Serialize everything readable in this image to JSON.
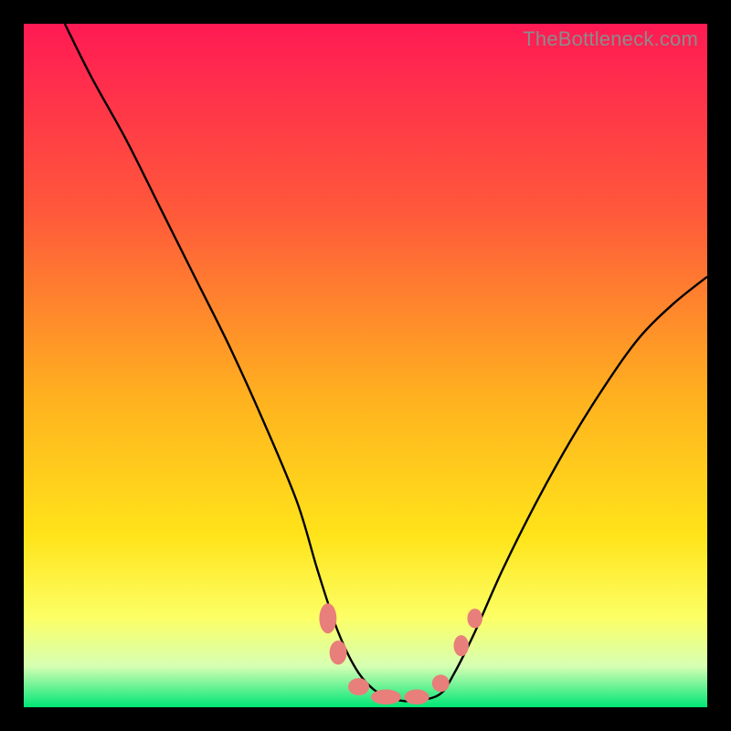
{
  "attribution": "TheBottleneck.com",
  "chart_data": {
    "type": "line",
    "title": "",
    "xlabel": "",
    "ylabel": "",
    "xlim": [
      0,
      100
    ],
    "ylim": [
      0,
      100
    ],
    "gradient_stops": [
      {
        "offset": 0,
        "color": "#ff1a54"
      },
      {
        "offset": 28,
        "color": "#ff5a3a"
      },
      {
        "offset": 55,
        "color": "#ffb21f"
      },
      {
        "offset": 75,
        "color": "#ffe41a"
      },
      {
        "offset": 87,
        "color": "#fcff66"
      },
      {
        "offset": 94,
        "color": "#d6ffb3"
      },
      {
        "offset": 100,
        "color": "#00e676"
      }
    ],
    "series": [
      {
        "name": "bottleneck-curve",
        "x": [
          6,
          10,
          15,
          20,
          25,
          30,
          35,
          40,
          43,
          46,
          49,
          52,
          55,
          58,
          61,
          63,
          66,
          70,
          75,
          80,
          85,
          90,
          95,
          100
        ],
        "y": [
          100,
          92,
          83,
          73,
          63,
          53,
          42,
          30,
          20,
          11,
          5,
          2,
          1,
          1,
          2,
          5,
          11,
          20,
          30,
          39,
          47,
          54,
          59,
          63
        ]
      }
    ],
    "markers": {
      "name": "highlighted-points",
      "color": "#e87f7a",
      "points": [
        {
          "x": 44.5,
          "y": 13,
          "rx": 2.3,
          "ry": 4.0
        },
        {
          "x": 46.0,
          "y": 8,
          "rx": 2.3,
          "ry": 3.2
        },
        {
          "x": 49.0,
          "y": 3,
          "rx": 2.8,
          "ry": 2.3
        },
        {
          "x": 53.0,
          "y": 1.5,
          "rx": 4.0,
          "ry": 2.0
        },
        {
          "x": 57.5,
          "y": 1.5,
          "rx": 3.3,
          "ry": 2.0
        },
        {
          "x": 61.0,
          "y": 3.5,
          "rx": 2.3,
          "ry": 2.3
        },
        {
          "x": 64.0,
          "y": 9,
          "rx": 2.0,
          "ry": 2.8
        },
        {
          "x": 66.0,
          "y": 13,
          "rx": 2.0,
          "ry": 2.6
        }
      ]
    }
  }
}
